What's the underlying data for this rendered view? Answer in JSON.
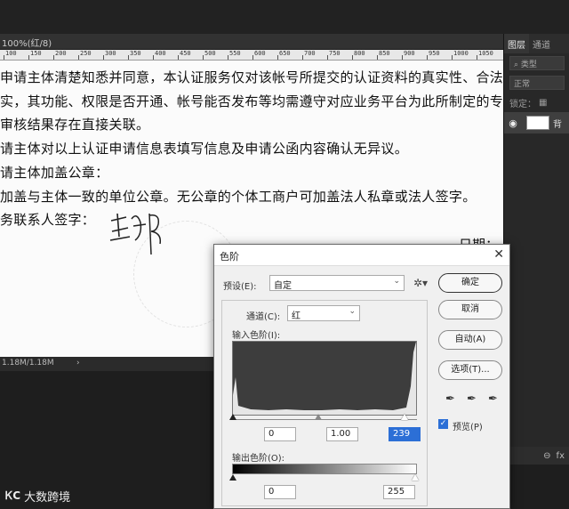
{
  "document": {
    "tab_title": "100%(红/8)",
    "ruler_ticks": [
      "100",
      "150",
      "200",
      "250",
      "300",
      "350",
      "400",
      "450",
      "500",
      "550",
      "600",
      "650",
      "700",
      "750",
      "800",
      "850",
      "900",
      "950",
      "1000",
      "1050"
    ],
    "lines": [
      "申请主体清楚知悉并同意，本认证服务仅对该帐号所提交的认证资料的真实性、合法",
      "实，其功能、权限是否开通、帐号能否发布等均需遵守对应业务平台为此所制定的专",
      "审核结果存在直接关联。",
      "请主体对以上认证申请信息表填写信息及申请公函内容确认无异议。",
      "请主体加盖公章：",
      "加盖与主体一致的单位公章。无公章的个体工商户可加盖法人私章或法人签字。",
      "务联系人签字："
    ],
    "date_label": "日期：",
    "status_text": "1.18M/1.18M"
  },
  "panel": {
    "tabs": [
      "图层",
      "通道"
    ],
    "filter_label": "类型",
    "blend_mode": "正常",
    "lock_label": "锁定：",
    "layer_name": "背"
  },
  "levels_dialog": {
    "title": "色阶",
    "preset_label": "预设(E):",
    "preset_value": "自定",
    "channel_label": "通道(C):",
    "channel_value": "红",
    "input_label": "输入色阶(I):",
    "input_black": "0",
    "input_gamma": "1.00",
    "input_white": "239",
    "output_label": "输出色阶(O):",
    "output_black": "0",
    "output_white": "255",
    "buttons": {
      "ok": "确定",
      "cancel": "取消",
      "auto": "自动(A)",
      "options": "选项(T)..."
    },
    "preview_label": "预览(P)",
    "preview_checked": true
  },
  "watermark": {
    "logo": "ᏦC",
    "text": "大数跨境"
  }
}
